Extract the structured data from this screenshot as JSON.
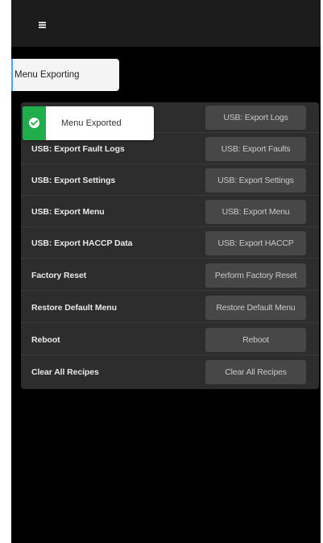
{
  "header": {
    "menu_icon": "hamburger-icon"
  },
  "tab": {
    "label": "Menu Exporting"
  },
  "toast": {
    "message": "Menu Exported",
    "icon": "check-circle-icon",
    "color": "#1fae4b"
  },
  "rows": [
    {
      "label": "",
      "button": "USB: Export Logs"
    },
    {
      "label": "USB: Export Fault Logs",
      "button": "USB: Export Faults"
    },
    {
      "label": "USB: Export Settings",
      "button": "USB: Export Settings"
    },
    {
      "label": "USB: Export Menu",
      "button": "USB: Export Menu"
    },
    {
      "label": "USB: Export HACCP Data",
      "button": "USB: Export HACCP"
    },
    {
      "label": "Factory Reset",
      "button": "Perform Factory Reset"
    },
    {
      "label": "Restore Default Menu",
      "button": "Restore Default Menu"
    },
    {
      "label": "Reboot",
      "button": "Reboot"
    },
    {
      "label": "Clear All Recipes",
      "button": "Clear All Recipes"
    }
  ]
}
